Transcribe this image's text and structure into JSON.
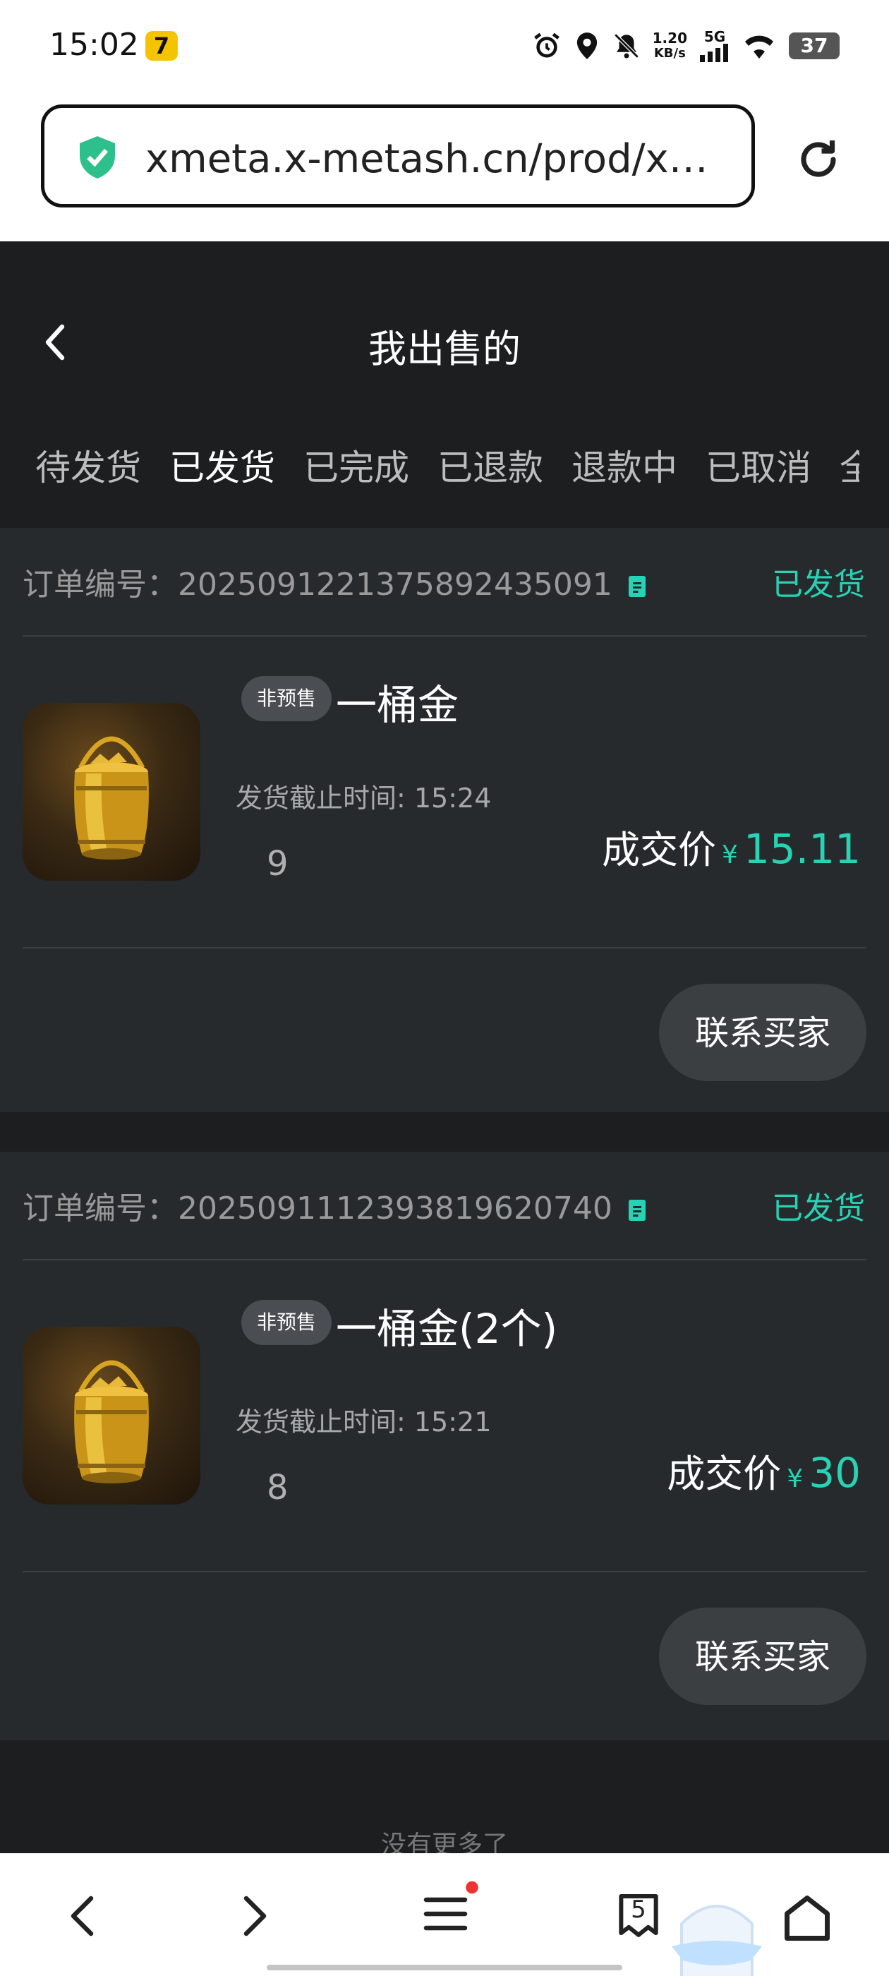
{
  "status_bar": {
    "time": "15:02",
    "app_badge": "7",
    "net_speed_value": "1.20",
    "net_speed_unit": "KB/s",
    "network": "5G",
    "battery": "37"
  },
  "browser": {
    "url": "xmeta.x-metash.cn/prod/x…",
    "tab_count": "5"
  },
  "header": {
    "title": "我出售的"
  },
  "tabs": [
    {
      "label": "待发货"
    },
    {
      "label": "已发货"
    },
    {
      "label": "已完成"
    },
    {
      "label": "已退款"
    },
    {
      "label": "退款中"
    },
    {
      "label": "已取消"
    },
    {
      "label": "全"
    }
  ],
  "active_tab": "已发货",
  "orders": [
    {
      "order_label": "订单编号：",
      "order_no": "20250912213758924350​91",
      "status": "已发货",
      "badge": "非预售",
      "product": "一桶金",
      "deadline": "发货截止时间: 15:24",
      "qty": "9",
      "price_label": "成交价",
      "currency": "¥",
      "price": "15.11",
      "contact_label": "联系买家"
    },
    {
      "order_label": "订单编号：",
      "order_no": "20250911123938196207​40",
      "status": "已发货",
      "badge": "非预售",
      "product": "一桶金(2个)",
      "deadline": "发货截止时间: 15:21",
      "qty": "8",
      "price_label": "成交价",
      "currency": "¥",
      "price": "30",
      "contact_label": "联系买家"
    }
  ],
  "footer_text": "没有更多了",
  "colors": {
    "accent": "#27d3b4",
    "page_bg": "#1c1e20",
    "card_bg": "#272a2d"
  }
}
